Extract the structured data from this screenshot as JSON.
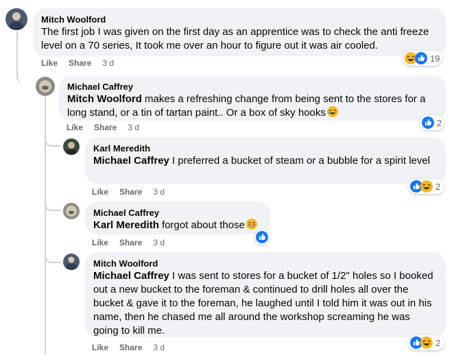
{
  "comments": [
    {
      "author": "Mitch Woolford",
      "text": "The first job I was given on the first day as an apprentice was to check the anti freeze level on a 70 series, It took me over an hour to figure out it was air cooled.",
      "actions": {
        "like": "Like",
        "share": "Share",
        "time": "3 d"
      },
      "reactions": {
        "icons": [
          "haha-icon",
          "like-icon"
        ],
        "count": "19"
      }
    },
    {
      "author": "Michael Caffrey",
      "mention": "Mitch Woolford",
      "text": "makes a refreshing change from being sent to the stores for a long stand, or a tin of tartan paint.. Or a box of sky hooks",
      "actions": {
        "like": "Like",
        "share": "Share",
        "time": "3 d"
      },
      "reactions": {
        "icons": [
          "like-icon"
        ],
        "count": "2"
      }
    },
    {
      "author": "Karl Meredith",
      "mention": "Michael Caffrey",
      "text": "I preferred a bucket of steam or a bubble for a spirit level",
      "actions": {
        "like": "Like",
        "share": "Share",
        "time": "3 d"
      },
      "reactions": {
        "icons": [
          "like-icon",
          "haha-icon"
        ],
        "count": "2"
      }
    },
    {
      "author": "Michael Caffrey",
      "mention": "Karl Meredith",
      "text": "forgot about those",
      "actions": {
        "like": "Like",
        "share": "Share",
        "time": "3 d"
      },
      "reactions": {
        "icons": [
          "like-icon"
        ],
        "count": ""
      }
    },
    {
      "author": "Mitch Woolford",
      "mention": "Michael Caffrey",
      "text": "I was sent to stores for a bucket of 1/2\" holes so I booked out a new bucket to the foreman & continued to drill holes all over the bucket & gave it to the foreman, he laughed until I told him it was out in his name, then he chased me all around the workshop screaming he was going to kill me.",
      "actions": {
        "like": "Like",
        "share": "Share",
        "time": "3 d"
      },
      "reactions": {
        "icons": [
          "like-icon",
          "haha-icon"
        ],
        "count": "2"
      }
    }
  ],
  "colors": {
    "bubble": "#f0f2f5",
    "like_blue": "#1877f2",
    "haha_yellow": "#f7b928",
    "meta_gray": "#65676b"
  }
}
